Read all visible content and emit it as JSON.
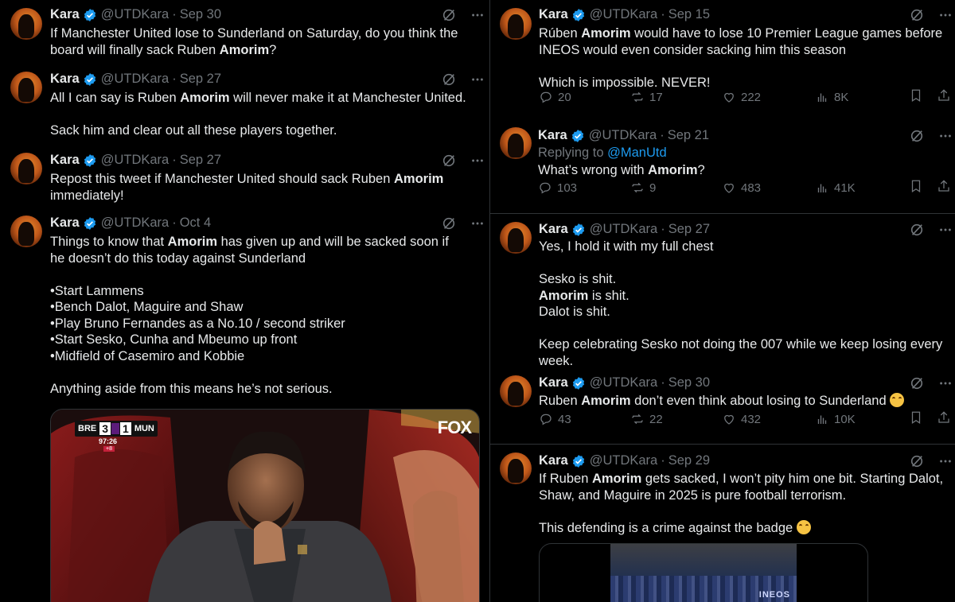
{
  "author": {
    "name": "Kara",
    "handle": "@UTDKara"
  },
  "colors": {
    "background": "#000000",
    "text": "#e7e9ea",
    "muted": "#71767b",
    "accent": "#1d9bf0",
    "verified": "#1d9bf0"
  },
  "left_tweets": [
    {
      "date": "Sep 30",
      "lines": [
        [
          "If Manchester United lose to Sunderland on Saturday, do you think the"
        ],
        [
          "board will finally sack Ruben ",
          {
            "b": "Amorim"
          },
          "?"
        ]
      ]
    },
    {
      "date": "Sep 27",
      "lines": [
        [
          "All I can say is Ruben ",
          {
            "b": "Amorim"
          },
          " will never make it at Manchester United."
        ],
        [],
        [
          "Sack him and clear out all these players together."
        ]
      ]
    },
    {
      "date": "Sep 27",
      "lines": [
        [
          "Repost this tweet if Manchester United should sack Ruben ",
          {
            "b": "Amorim"
          }
        ],
        [
          "immediately!"
        ]
      ]
    },
    {
      "date": "Oct 4",
      "lines": [
        [
          "Things to know that ",
          {
            "b": "Amorim"
          },
          " has given up and will be sacked soon if"
        ],
        [
          "he doesn’t do this today against Sunderland"
        ],
        [],
        [
          "•Start Lammens"
        ],
        [
          "•Bench Dalot, Maguire and Shaw"
        ],
        [
          "•Play Bruno Fernandes as a No.10 / second striker"
        ],
        [
          "•Start Sesko, Cunha and Mbeumo up front"
        ],
        [
          "•Midfield of Casemiro and Kobbie"
        ],
        [],
        [
          "Anything aside from this means he’s not serious."
        ]
      ],
      "media": {
        "scoreboard": {
          "home": "BRE",
          "home_score": "3",
          "away_score": "1",
          "away": "MUN",
          "clock": "97:26",
          "added": "+8"
        },
        "broadcaster": "FOX"
      }
    }
  ],
  "right_tweets": [
    {
      "date": "Sep 15",
      "lines": [
        [
          "Rúben ",
          {
            "b": "Amorim"
          },
          " would have to lose 10 Premier League games before"
        ],
        [
          "INEOS would even consider sacking him this season"
        ],
        [],
        [
          "Which is impossible. NEVER!"
        ]
      ],
      "stats": {
        "replies": "20",
        "reposts": "17",
        "likes": "222",
        "views": "8K"
      }
    },
    {
      "date": "Sep 21",
      "reply_to_label": "Replying to ",
      "reply_to": "@ManUtd",
      "lines": [
        [
          "What’s wrong with ",
          {
            "b": "Amorim"
          },
          "?"
        ]
      ],
      "stats": {
        "replies": "103",
        "reposts": "9",
        "likes": "483",
        "views": "41K"
      }
    },
    {
      "date": "Sep 27",
      "lines": [
        [
          "Yes, I hold it with my full chest"
        ],
        [],
        [
          "Sesko is shit."
        ],
        [
          {
            "b": "Amorim"
          },
          " is shit."
        ],
        [
          "Dalot is shit."
        ],
        [],
        [
          "Keep celebrating Sesko not doing the 007 while we keep losing every"
        ],
        [
          "week."
        ]
      ]
    },
    {
      "date": "Sep 30",
      "lines": [
        [
          "Ruben ",
          {
            "b": "Amorim"
          },
          " don’t even think about losing to Sunderland ",
          {
            "emoji": "loudly-crying-face"
          }
        ]
      ],
      "stats": {
        "replies": "43",
        "reposts": "22",
        "likes": "432",
        "views": "10K"
      }
    },
    {
      "date": "Sep 29",
      "lines": [
        [
          "If Ruben ",
          {
            "b": "Amorim"
          },
          " gets sacked, I won’t pity him one bit. Starting Dalot,"
        ],
        [
          "Shaw, and Maguire in 2025 is pure football terrorism."
        ],
        [],
        [
          "This defending is a crime against the badge ",
          {
            "emoji": "loudly-crying-face"
          }
        ]
      ],
      "media": {
        "overlay_text": "INEOS"
      }
    }
  ]
}
